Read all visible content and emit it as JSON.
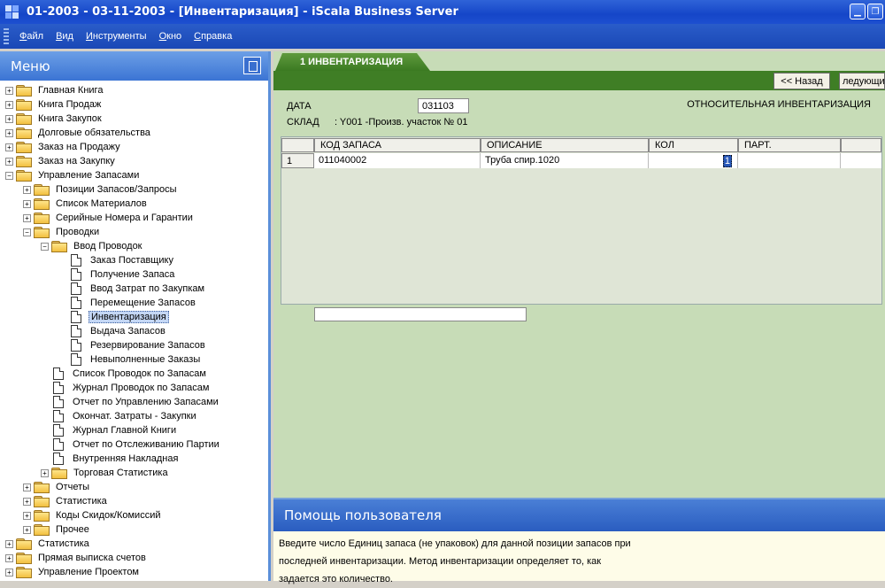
{
  "window": {
    "title": "01-2003 - 03-11-2003 - [Инвентаризация] - iScala Business Server"
  },
  "menubar": {
    "items": [
      "Файл",
      "Вид",
      "Инструменты",
      "Окно",
      "Справка"
    ]
  },
  "menu_pane": {
    "title": "Меню",
    "tree": [
      {
        "label": "Главная Книга",
        "level": 0,
        "type": "folder",
        "expand": "+"
      },
      {
        "label": "Книга Продаж",
        "level": 0,
        "type": "folder",
        "expand": "+"
      },
      {
        "label": "Книга Закупок",
        "level": 0,
        "type": "folder",
        "expand": "+"
      },
      {
        "label": "Долговые обязательства",
        "level": 0,
        "type": "folder",
        "expand": "+"
      },
      {
        "label": "Заказ на Продажу",
        "level": 0,
        "type": "folder",
        "expand": "+"
      },
      {
        "label": "Заказ на Закупку",
        "level": 0,
        "type": "folder",
        "expand": "+"
      },
      {
        "label": "Управление Запасами",
        "level": 0,
        "type": "folder",
        "expand": "-"
      },
      {
        "label": "Позиции Запасов/Запросы",
        "level": 1,
        "type": "folder",
        "expand": "+"
      },
      {
        "label": "Список Материалов",
        "level": 1,
        "type": "folder",
        "expand": "+"
      },
      {
        "label": "Серийные Номера и Гарантии",
        "level": 1,
        "type": "folder",
        "expand": "+"
      },
      {
        "label": "Проводки",
        "level": 1,
        "type": "folder",
        "expand": "-"
      },
      {
        "label": "Ввод Проводок",
        "level": 2,
        "type": "folder",
        "expand": "-"
      },
      {
        "label": "Заказ Поставщику",
        "level": 3,
        "type": "doc"
      },
      {
        "label": "Получение Запаса",
        "level": 3,
        "type": "doc"
      },
      {
        "label": "Ввод Затрат по Закупкам",
        "level": 3,
        "type": "doc"
      },
      {
        "label": "Перемещение Запасов",
        "level": 3,
        "type": "doc"
      },
      {
        "label": "Инвентаризация",
        "level": 3,
        "type": "doc",
        "selected": true
      },
      {
        "label": "Выдача Запасов",
        "level": 3,
        "type": "doc"
      },
      {
        "label": "Резервирование Запасов",
        "level": 3,
        "type": "doc"
      },
      {
        "label": "Невыполненные Заказы",
        "level": 3,
        "type": "doc"
      },
      {
        "label": "Список Проводок по Запасам",
        "level": 2,
        "type": "doc"
      },
      {
        "label": "Журнал Проводок по Запасам",
        "level": 2,
        "type": "doc"
      },
      {
        "label": "Отчет по Управлению Запасами",
        "level": 2,
        "type": "doc"
      },
      {
        "label": "Окончат. Затраты - Закупки",
        "level": 2,
        "type": "doc"
      },
      {
        "label": "Журнал Главной Книги",
        "level": 2,
        "type": "doc"
      },
      {
        "label": "Отчет по Отслеживанию Партии",
        "level": 2,
        "type": "doc"
      },
      {
        "label": "Внутренняя Накладная",
        "level": 2,
        "type": "doc"
      },
      {
        "label": "Торговая Статистика",
        "level": 2,
        "type": "folder",
        "expand": "+"
      },
      {
        "label": "Отчеты",
        "level": 1,
        "type": "folder",
        "expand": "+"
      },
      {
        "label": "Статистика",
        "level": 1,
        "type": "folder",
        "expand": "+"
      },
      {
        "label": "Коды Скидок/Комиссий",
        "level": 1,
        "type": "folder",
        "expand": "+"
      },
      {
        "label": "Прочее",
        "level": 1,
        "type": "folder",
        "expand": "+"
      },
      {
        "label": "Статистика",
        "level": 0,
        "type": "folder",
        "expand": "+"
      },
      {
        "label": "Прямая выписка счетов",
        "level": 0,
        "type": "folder",
        "expand": "+"
      },
      {
        "label": "Управление Проектом",
        "level": 0,
        "type": "folder",
        "expand": "+"
      }
    ]
  },
  "document": {
    "tab_label": "1 ИНВЕНТАРИЗАЦИЯ",
    "toolbar": {
      "back_label": "<< Назад",
      "next_label": "ледующи"
    },
    "form": {
      "date_label": "ДАТА",
      "date_value": "031103",
      "warehouse_label": "СКЛАД",
      "warehouse_value": ": Y001  -Произв. участок № 01",
      "mode_text": "ОТНОСИТЕЛЬНАЯ ИНВЕНТАРИЗАЦИЯ"
    },
    "grid": {
      "columns": [
        "КОД ЗАПАСА",
        "ОПИСАНИЕ",
        "КОЛ",
        "ПАРТ."
      ],
      "rows": [
        {
          "num": "1",
          "code": "011040002",
          "description": "Труба спир.1020",
          "qty": "1",
          "lot": ""
        }
      ]
    }
  },
  "help": {
    "title": "Помощь пользователя",
    "lines": [
      "Введите число Единиц запаса (не упаковок) для данной позиции запасов при",
      "последней инвентаризации. Метод инвентаризации определяет то, как",
      "задается это количество."
    ]
  }
}
